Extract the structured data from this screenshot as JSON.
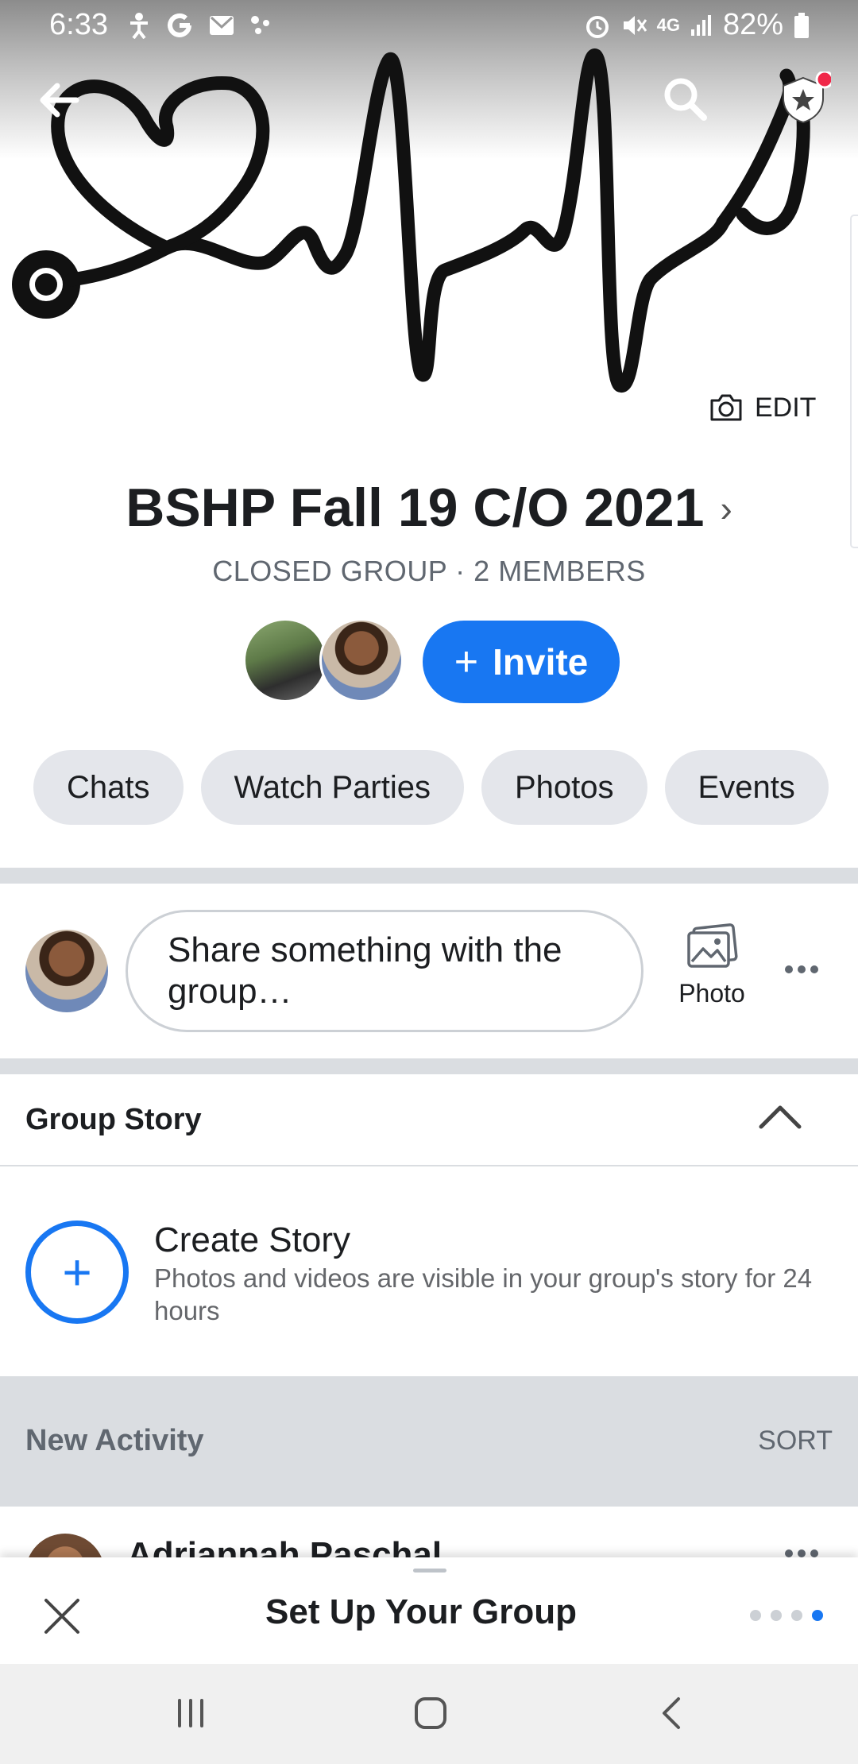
{
  "status_bar": {
    "time": "6:33",
    "battery": "82%",
    "network": "4G"
  },
  "cover": {
    "edit_label": "EDIT",
    "art": "heartbeat-stethoscope-icon"
  },
  "group": {
    "title": "BSHP Fall 19 C/O 2021",
    "subtitle": "CLOSED GROUP · 2 MEMBERS",
    "invite_label": "Invite"
  },
  "chips": [
    {
      "label": "Chats"
    },
    {
      "label": "Watch Parties"
    },
    {
      "label": "Photos"
    },
    {
      "label": "Events"
    }
  ],
  "composer": {
    "placeholder": "Share something with the group…",
    "photo_label": "Photo"
  },
  "story": {
    "header": "Group Story",
    "create_title": "Create Story",
    "create_desc": "Photos and videos are visible in your group's story for 24 hours"
  },
  "activity": {
    "header": "New Activity",
    "sort_label": "SORT",
    "first_post_author": "Adriannah Paschal"
  },
  "setup_sheet": {
    "title": "Set Up Your Group",
    "steps_total": 4,
    "step_current": 4
  },
  "colors": {
    "accent": "#1877f2",
    "chip_bg": "#e4e6eb",
    "divider": "#dadde1"
  }
}
